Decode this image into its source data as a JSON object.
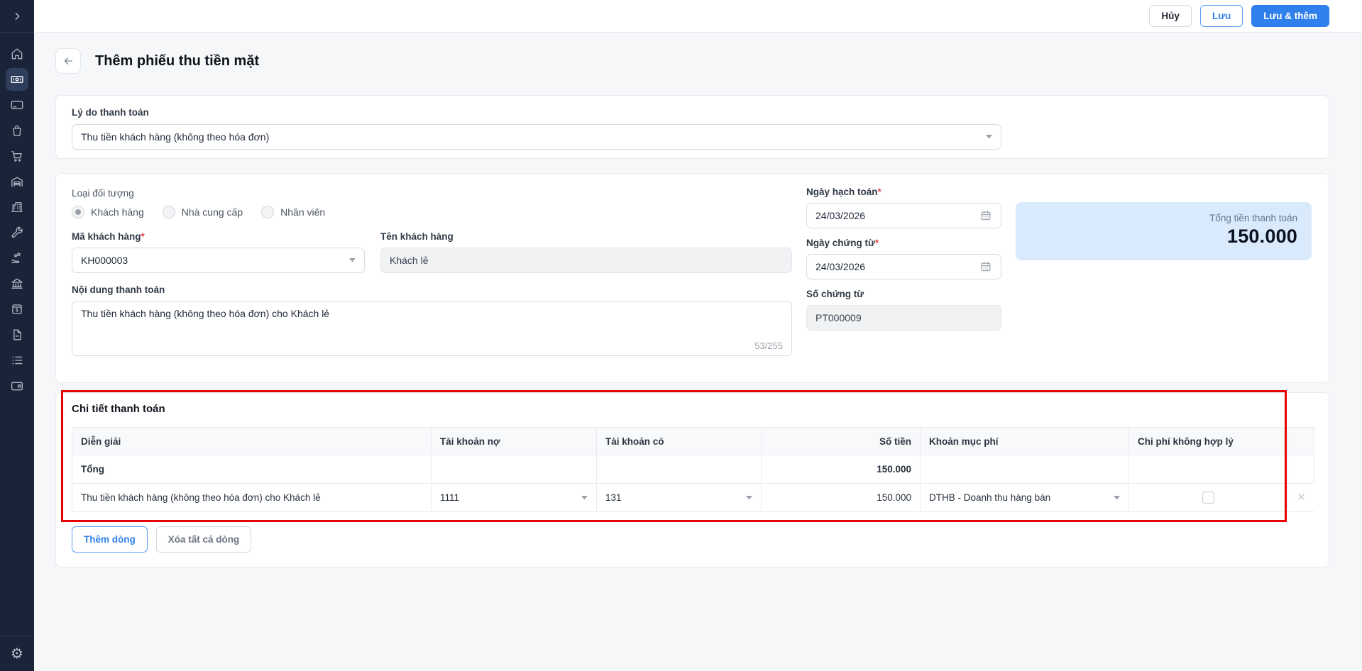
{
  "topbar": {
    "cancel_label": "Hủy",
    "save_label": "Lưu",
    "save_and_add_label": "Lưu & thêm"
  },
  "page": {
    "title": "Thêm phiếu thu tiền mặt"
  },
  "sidebar": {
    "icons": [
      "chevron-right",
      "home",
      "banknote",
      "credit-card",
      "shopping-bag",
      "shopping-cart",
      "warehouse",
      "building",
      "wrench",
      "hand-coins",
      "bank",
      "cash-box",
      "document",
      "list",
      "wallet",
      "settings"
    ],
    "active_icon": "banknote"
  },
  "reason_card": {
    "label": "Lý do thanh toán",
    "value": "Thu tiền khách hàng (không theo hóa đơn)"
  },
  "info_card": {
    "object_type_label": "Loại đối tượng",
    "object_types": [
      {
        "label": "Khách hàng",
        "selected": true
      },
      {
        "label": "Nhà cung cấp",
        "selected": false
      },
      {
        "label": "Nhân viên",
        "selected": false
      }
    ],
    "customer_code": {
      "label": "Mã khách hàng",
      "required": "*",
      "value": "KH000003"
    },
    "customer_name": {
      "label": "Tên khách hàng",
      "value": "Khách lẻ"
    },
    "payment_content": {
      "label": "Nội dung thanh toán",
      "value": "Thu tiền khách hàng (không theo hóa đơn) cho Khách lẻ",
      "counter": "53/255"
    },
    "posting_date": {
      "label": "Ngày hạch toán",
      "required": "*",
      "value": "24/03/2026"
    },
    "document_date": {
      "label": "Ngày chứng từ",
      "required": "*",
      "value": "24/03/2026"
    },
    "document_number": {
      "label": "Số chứng từ",
      "value": "PT000009"
    },
    "total_box": {
      "label": "Tổng tiền thanh toán",
      "amount": "150.000"
    }
  },
  "detail_card": {
    "title": "Chi tiết thanh toán",
    "columns": {
      "description": "Diễn giải",
      "debit_account": "Tài khoản nợ",
      "credit_account": "Tài khoản có",
      "amount": "Số tiền",
      "fee_category": "Khoản mục phí",
      "invalid_expense": "Chi phí không hợp lý"
    },
    "total_row": {
      "label": "Tổng",
      "amount": "150.000"
    },
    "rows": [
      {
        "description": "Thu tiền khách hàng (không theo hóa đơn) cho Khách lẻ",
        "debit_account": "1111",
        "credit_account": "131",
        "amount": "150.000",
        "fee_category": "DTHB - Doanh thu hàng bán",
        "invalid_expense_checked": false
      }
    ],
    "add_row_label": "Thêm dòng",
    "delete_all_label": "Xóa tất cả dòng"
  },
  "colors": {
    "accent": "#2f80ed",
    "annotation": "#e60202",
    "sidebar_bg": "#1a2438",
    "total_box_bg": "#d9eafc"
  }
}
